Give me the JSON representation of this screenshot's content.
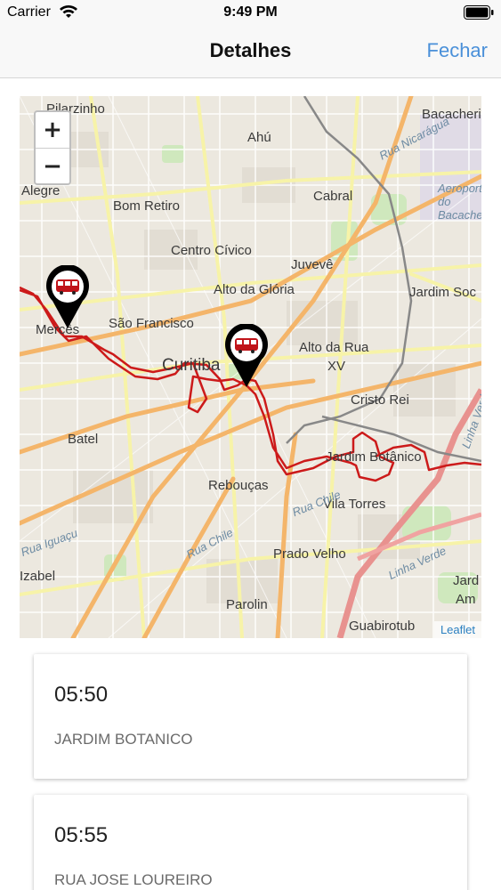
{
  "status_bar": {
    "carrier": "Carrier",
    "time": "9:49 PM"
  },
  "nav": {
    "title": "Detalhes",
    "close_label": "Fechar"
  },
  "map": {
    "zoom_in": "+",
    "zoom_out": "−",
    "attribution": "Leaflet",
    "route_color": "#cc1a1a",
    "places": [
      "Pilarzinho",
      "Ahú",
      "Bacacheri",
      "Alegre",
      "Bom Retiro",
      "Cabral",
      "Centro Cívico",
      "Juvevê",
      "Alto da Glória",
      "Jardim Soc",
      "São Francisco",
      "Mercês",
      "Alto da Rua",
      "XV",
      "Curitiba",
      "Cristo Rei",
      "Batel",
      "Jardim Botânico",
      "Rebouças",
      "Vila Torres",
      "Prado Velho",
      "Izabel",
      "Parolin",
      "Jard",
      "Am",
      "Guabirotub"
    ],
    "road_labels": [
      "Rua Nicarágua",
      "Rua Chile",
      "Rua Chile",
      "Linha Verde",
      "Linha Verde",
      "Rua Iguaçu",
      "Aeroporto do Bacacheri"
    ],
    "markers": [
      {
        "icon": "bus-icon",
        "label": "bus-stop-marker"
      },
      {
        "icon": "bus-icon",
        "label": "bus-stop-marker"
      }
    ]
  },
  "schedule": [
    {
      "time": "05:50",
      "stop": "JARDIM BOTANICO"
    },
    {
      "time": "05:55",
      "stop": "RUA JOSE LOUREIRO"
    }
  ]
}
